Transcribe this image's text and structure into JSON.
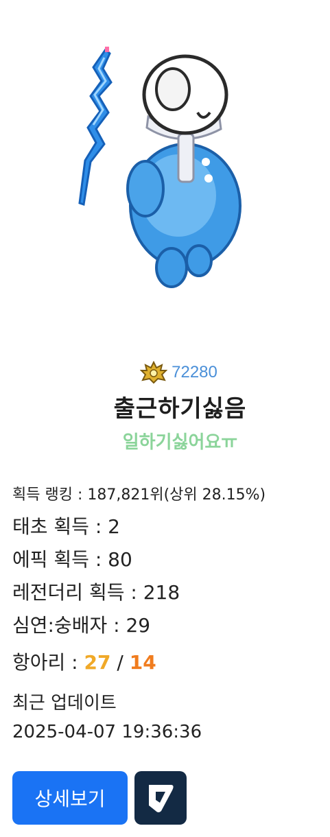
{
  "profile": {
    "rank_number": "72280",
    "nickname": "출근하기싫음",
    "status_message": "일하기싫어요ㅠ",
    "rank_icon": "gold-crown-emblem-icon",
    "avatar_icon": "snowman-character-with-ice-wand"
  },
  "stats": {
    "ranking": "획득 랭킹 : 187,821위(상위 28.15%)",
    "taecho": "태초 획득 : 2",
    "epic": "에픽 획득 : 80",
    "legendary": "레전더리 획득 : 218",
    "simyeon": "심연:숭배자 : 29",
    "hangari_label": "항아리 : ",
    "hangari_a": "27",
    "hangari_sep": " / ",
    "hangari_b": "14"
  },
  "update": {
    "label": "최근 업데이트",
    "time": "2025-04-07 19:36:36"
  },
  "buttons": {
    "detail_label": "상세보기",
    "logo_icon": "dundam-logo-icon"
  },
  "colors": {
    "rank_number": "#4a8fd8",
    "status_message": "#8bd49a",
    "hangari_a": "#f0a928",
    "hangari_b": "#f07c1e",
    "detail_button": "#1a73f4",
    "logo_button": "#132a44"
  }
}
